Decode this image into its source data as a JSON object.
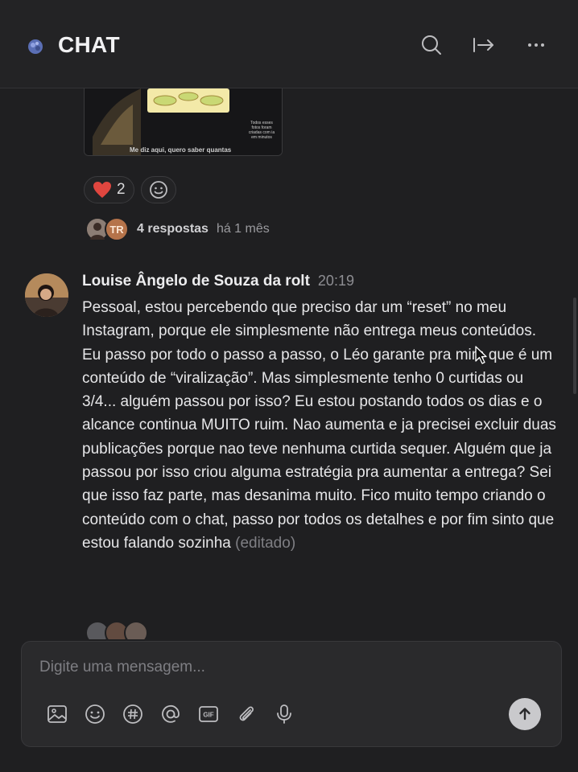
{
  "header": {
    "title": "CHAT",
    "icons": [
      "chat-logo-icon",
      "search-icon",
      "exit-to-right-icon",
      "more-horizontal-icon"
    ]
  },
  "previous_message": {
    "image_caption": "Me diz aqui, quero saber quantas",
    "image_note": "Todos esses fotos foram criadas com ia em minutos",
    "reactions": [
      {
        "emoji": "❤️",
        "count": "2"
      }
    ],
    "add_reaction_icon": "smiley-icon",
    "thread": {
      "avatar_initials": "TR",
      "replies_label": "4 respostas",
      "ago": "há 1 mês"
    }
  },
  "message": {
    "author": "Louise Ângelo de Souza da rolt",
    "time": "20:19",
    "text": "Pessoal, estou percebendo que preciso dar um “reset” no meu Instagram, porque ele simplesmente não entrega meus conteúdos. Eu passo por todo o passo a passo, o Léo garante pra mim que é um conteúdo de “viralização”. Mas simplesmente tenho 0 curtidas ou 3/4... alguém passou por isso? Eu estou postando todos os dias e o alcance continua MUITO ruim. Nao aumenta e ja precisei excluir duas publicações porque nao teve nenhuma curtida sequer. Alguém que ja passou por isso  criou alguma estratégia pra aumentar a entrega? Sei que isso faz parte, mas desanima muito. Fico muito tempo criando o conteúdo com o chat, passo por todos os detalhes e por fim sinto que estou falando sozinha",
    "edited_label": "(editado)"
  },
  "composer": {
    "placeholder": "Digite uma mensagem...",
    "tools": [
      "image-icon",
      "emoji-icon",
      "hashtag-icon",
      "mention-icon",
      "gif-icon",
      "attachment-icon",
      "microphone-icon"
    ],
    "send_icon": "arrow-up-icon"
  },
  "colors": {
    "background": "#1f1f21",
    "header": "#232325",
    "text": "#e4e4e6",
    "muted": "#8e8e93",
    "heart": "#e0463f",
    "avatar_tr": "#b5734a",
    "send_button": "#c9c9cc"
  }
}
